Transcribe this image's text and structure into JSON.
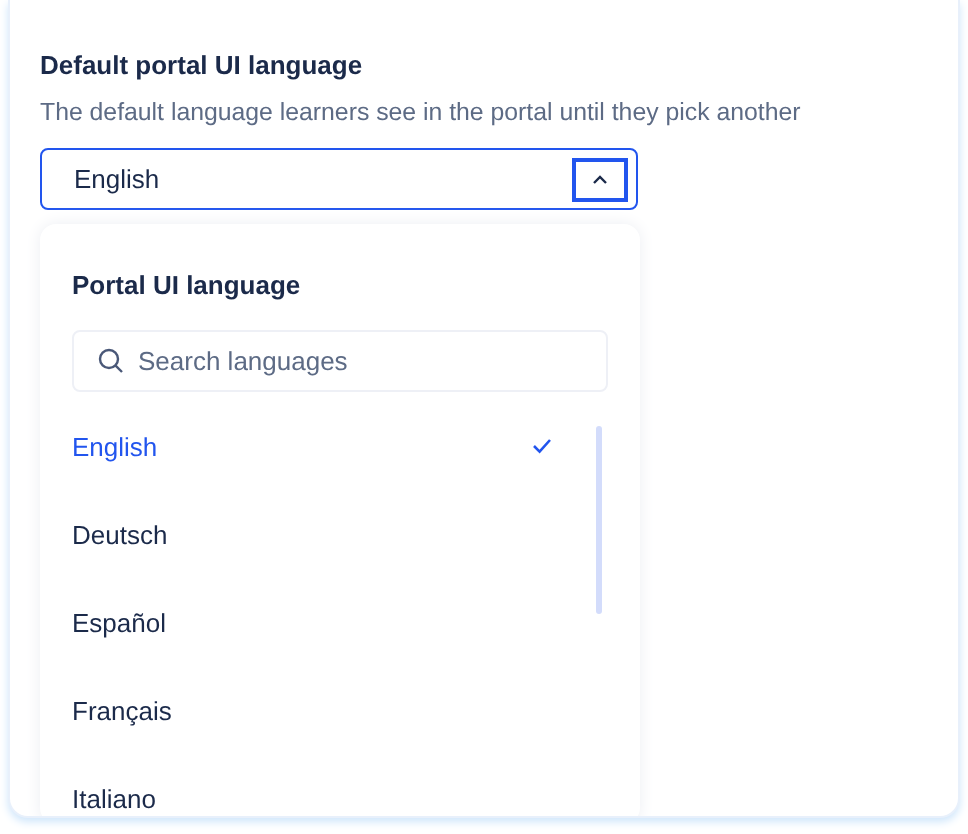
{
  "field": {
    "label": "Default portal UI language",
    "description": "The default language learners see in the portal until they pick another",
    "value": "English",
    "expanded": true
  },
  "dropdown": {
    "heading": "Portal UI language",
    "search": {
      "placeholder": "Search languages"
    },
    "options": [
      {
        "label": "English",
        "selected": true
      },
      {
        "label": "Deutsch",
        "selected": false
      },
      {
        "label": "Español",
        "selected": false
      },
      {
        "label": "Français",
        "selected": false
      },
      {
        "label": "Italiano",
        "selected": false
      }
    ]
  }
}
